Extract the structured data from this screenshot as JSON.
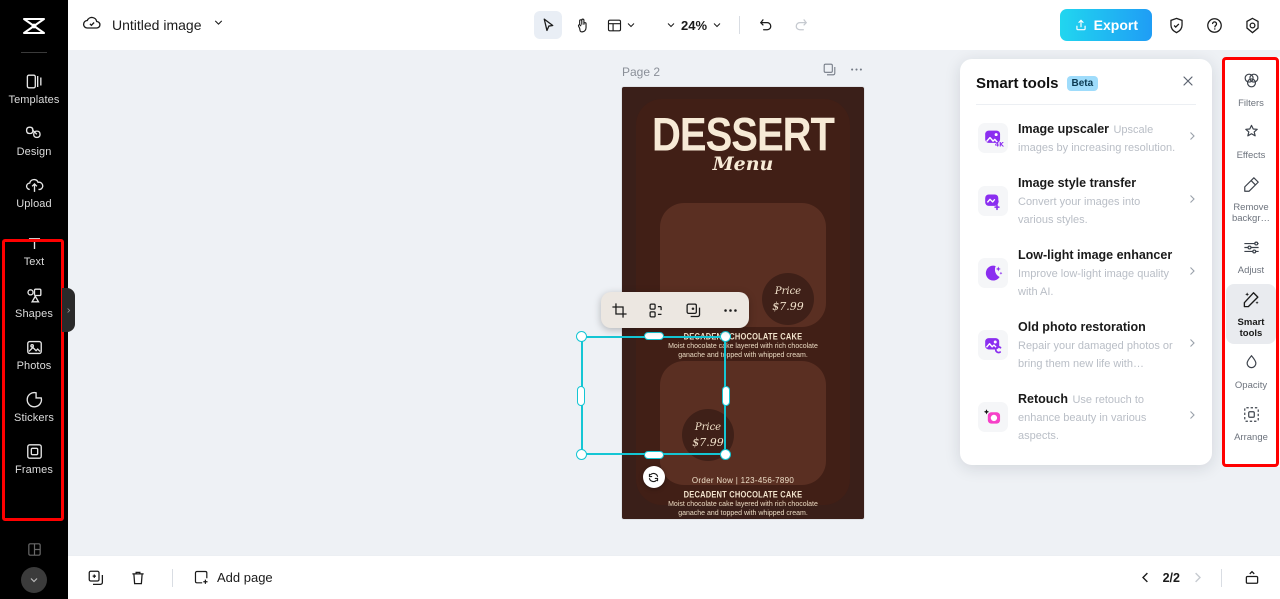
{
  "app": {
    "brand": "capcut-logo"
  },
  "left_sidebar": {
    "items": [
      {
        "label": "Templates",
        "icon": "templates-icon"
      },
      {
        "label": "Design",
        "icon": "design-icon"
      },
      {
        "label": "Upload",
        "icon": "upload-icon"
      },
      {
        "label": "Text",
        "icon": "text-icon"
      },
      {
        "label": "Shapes",
        "icon": "shapes-icon"
      },
      {
        "label": "Photos",
        "icon": "photos-icon"
      },
      {
        "label": "Stickers",
        "icon": "stickers-icon"
      },
      {
        "label": "Frames",
        "icon": "frames-icon"
      }
    ],
    "collapse_icon": "chevron-down-icon",
    "highlight_color": "#ff0000"
  },
  "topbar": {
    "cloud_icon": "cloud-sync-icon",
    "title": "Untitled image",
    "title_caret": "chevron-down-icon",
    "tools": [
      {
        "name": "select-tool",
        "icon": "cursor-arrow-icon",
        "active": true
      },
      {
        "name": "hand-tool",
        "icon": "hand-icon",
        "active": false
      },
      {
        "name": "layout-tool",
        "icon": "layout-grid-icon",
        "active": false
      }
    ],
    "zoom_value": "24%",
    "undo_icon": "undo-icon",
    "redo_icon": "redo-icon",
    "export_label": "Export",
    "export_icon": "export-upload-icon",
    "export_color": "#21d6ef",
    "right_icons": [
      {
        "name": "shield-check-icon"
      },
      {
        "name": "help-question-icon"
      },
      {
        "name": "settings-gear-icon"
      }
    ]
  },
  "canvas": {
    "page_label": "Page 2",
    "page_duplicate_icon": "duplicate-page-icon",
    "page_more_icon": "more-options-icon",
    "element_toolbar": [
      {
        "name": "crop-button",
        "icon": "crop-icon"
      },
      {
        "name": "cutout-button",
        "icon": "cutout-icon"
      },
      {
        "name": "duplicate-button",
        "icon": "duplicate-icon"
      },
      {
        "name": "more-button",
        "icon": "more-options-icon"
      }
    ],
    "rotate_icon": "rotate-handle-icon",
    "selection_color": "#14c6d4",
    "design": {
      "title": "DESSERT",
      "subtitle": "Menu",
      "background_color": "#411f16",
      "items": [
        {
          "price_label": "Price",
          "price_value": "$7.99",
          "name": "DECADENT CHOCOLATE CAKE",
          "description": "Moist chocolate cake layered with rich chocolate ganache and topped with whipped cream."
        },
        {
          "price_label": "Price",
          "price_value": "$7.99",
          "name": "DECADENT CHOCOLATE CAKE",
          "description": "Moist chocolate cake layered with rich chocolate ganache and topped with whipped cream."
        }
      ],
      "footer": "Order Now  |  123-456-7890"
    }
  },
  "smart_panel": {
    "title": "Smart tools",
    "badge": "Beta",
    "close_icon": "close-icon",
    "tools": [
      {
        "name": "Image upscaler",
        "description": "Upscale images by increasing resolution.",
        "icon": "image-upscaler-4k-icon",
        "icon_color": "#8b2ef0"
      },
      {
        "name": "Image style transfer",
        "description": "Convert your images into various styles.",
        "icon": "image-style-transfer-icon",
        "icon_color": "#8b2ef0"
      },
      {
        "name": "Low-light image enhancer",
        "description": "Improve low-light image quality with AI.",
        "icon": "low-light-moon-icon",
        "icon_color": "#8b2ef0"
      },
      {
        "name": "Old photo restoration",
        "description": "Repair your damaged photos or bring them new life with…",
        "icon": "old-photo-restoration-icon",
        "icon_color": "#8b2ef0"
      },
      {
        "name": "Retouch",
        "description": "Use retouch to enhance beauty in various aspects.",
        "icon": "retouch-icon",
        "icon_color": "#f640c8"
      }
    ],
    "arrow_icon": "chevron-right-icon"
  },
  "right_rail": {
    "highlight_color": "#ff0000",
    "items": [
      {
        "label": "Filters",
        "icon": "filters-icon",
        "active": false
      },
      {
        "label": "Effects",
        "icon": "effects-icon",
        "active": false
      },
      {
        "label": "Remove backgr…",
        "icon": "remove-background-icon",
        "active": false
      },
      {
        "label": "Adjust",
        "icon": "adjust-sliders-icon",
        "active": false
      },
      {
        "label": "Smart tools",
        "icon": "smart-tools-wand-icon",
        "active": true
      },
      {
        "label": "Opacity",
        "icon": "opacity-drop-icon",
        "active": false
      },
      {
        "label": "Arrange",
        "icon": "arrange-icon",
        "active": false
      }
    ]
  },
  "bottombar": {
    "duplicate_icon": "duplicate-page-icon",
    "delete_icon": "trash-icon",
    "add_page_label": "Add page",
    "add_page_icon": "add-page-icon",
    "prev_icon": "chevron-left-icon",
    "next_icon": "chevron-right-icon",
    "page_indicator": "2/2",
    "fullscreen_icon": "present-icon"
  }
}
